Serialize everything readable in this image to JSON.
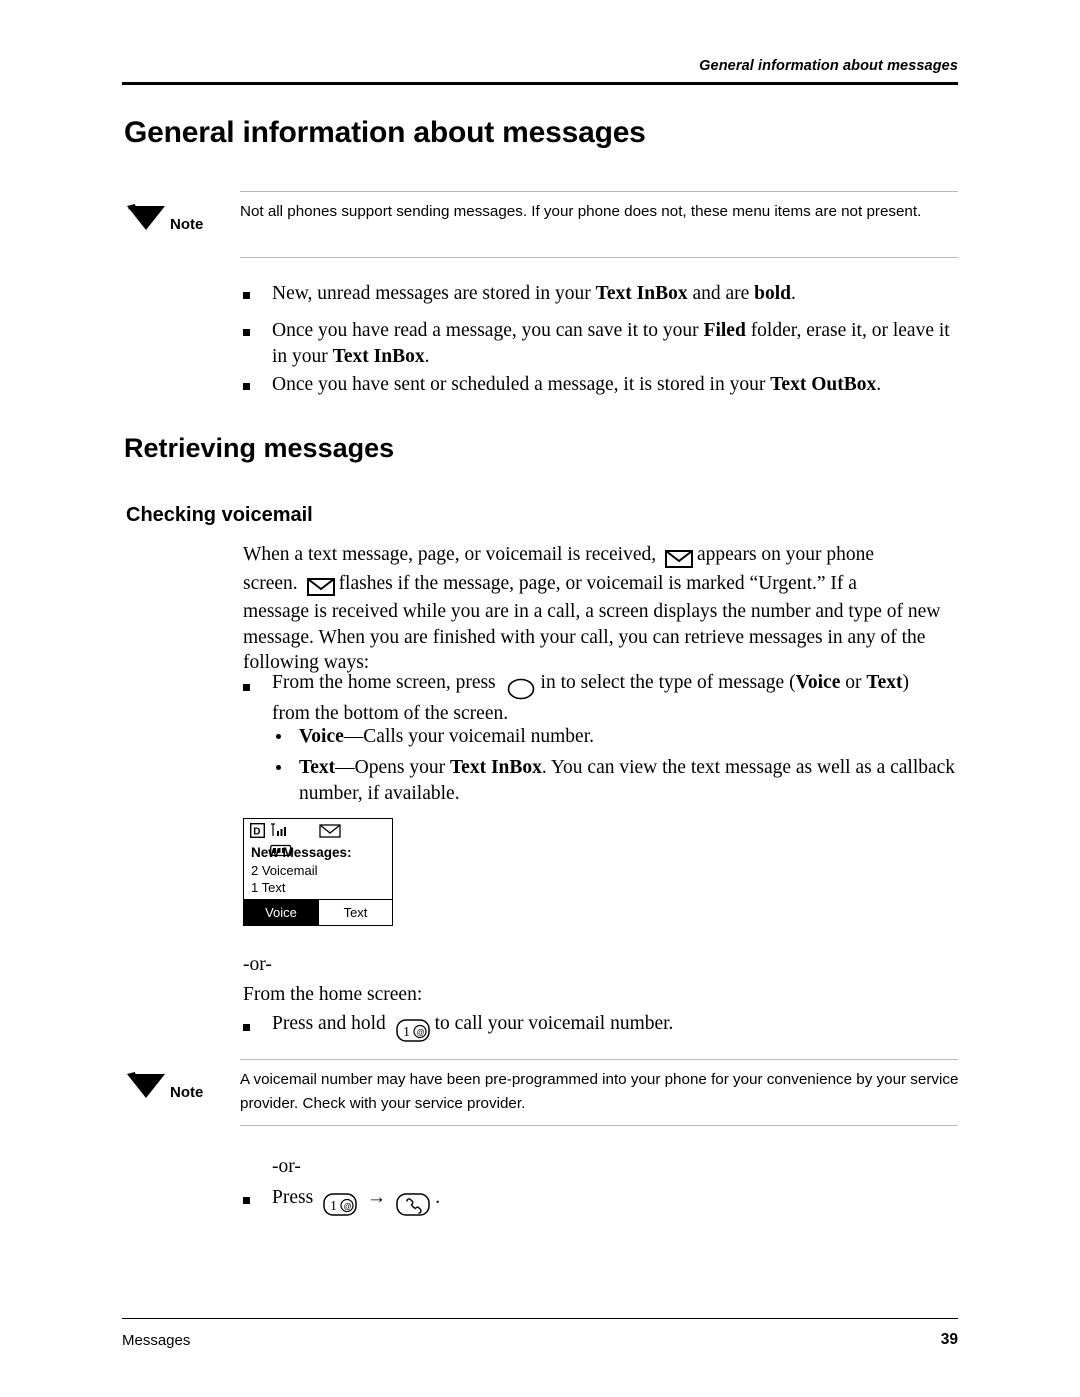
{
  "header": {
    "running_head": "General information about messages"
  },
  "footer": {
    "chapter": "Messages",
    "page_number": "39"
  },
  "headings": {
    "h1": "General information about messages",
    "h2": "Retrieving messages",
    "h3": "Checking voicemail"
  },
  "note1": {
    "label": "Note",
    "text": "Not all phones support sending messages. If your phone does not, these menu items are not present."
  },
  "note2": {
    "label": "Note",
    "text": "A voicemail number may have been pre-programmed into your phone for your convenience by your service provider. Check with your service provider."
  },
  "bullets_general": [
    {
      "parts": [
        {
          "t": "New, unread messages are stored in your ",
          "b": false
        },
        {
          "t": "Text InBox",
          "b": true
        },
        {
          "t": " and are ",
          "b": false
        },
        {
          "t": "bold",
          "b": true
        },
        {
          "t": ".",
          "b": false
        }
      ]
    },
    {
      "parts": [
        {
          "t": "Once you have read a message, you can save it to your ",
          "b": false
        },
        {
          "t": "Filed",
          "b": true
        },
        {
          "t": " folder, erase it, or leave it in your ",
          "b": false
        },
        {
          "t": "Text InBox",
          "b": true
        },
        {
          "t": ".",
          "b": false
        }
      ]
    },
    {
      "parts": [
        {
          "t": "Once you have sent or scheduled a message, it is stored in your ",
          "b": false
        },
        {
          "t": "Text OutBox",
          "b": true
        },
        {
          "t": ".",
          "b": false
        }
      ]
    }
  ],
  "voicemail": {
    "intro_1": "When a text message, page, or voicemail is received,",
    "intro_2": "appears on your phone",
    "intro_3": "screen.",
    "intro_4": "flashes if the message, page, or voicemail is marked “Urgent.” If a",
    "intro_rest": "message is received while you are in a call, a screen displays the number and type of new message. When you are finished with your call, you can retrieve messages in any of the following ways:",
    "bullet_press_1": "From the home screen, press",
    "bullet_press_2a": "in to select the type of message (",
    "bullet_press_voice": "Voice",
    "bullet_press_or": " or ",
    "bullet_press_text": "Text",
    "bullet_press_2b": ")",
    "bullet_press_3": "from the bottom of the screen.",
    "sub_voice_bold": "Voice",
    "sub_voice_rest": "—Calls your voicemail number.",
    "sub_text_bold": "Text",
    "sub_text_rest_a": "—Opens your ",
    "sub_text_bold2": "Text InBox",
    "sub_text_rest_b": ". You can view the text message as well as a callback number, if available.",
    "or_1": "-or-",
    "from_home": "From the home screen:",
    "press_hold_a": "Press and hold",
    "press_hold_b": "to call your voicemail number.",
    "or_2": "-or-",
    "press_final": "Press",
    "press_final_end": "."
  },
  "phone_screen": {
    "status_icons": [
      "digital-icon",
      "signal-bars-icon",
      "envelope-icon",
      "battery-icon"
    ],
    "title": "New Messages:",
    "line1": "2 Voicemail",
    "line2": "1 Text",
    "softkey_left": "Voice",
    "softkey_right": "Text"
  },
  "icons": {
    "note": "note-flag-icon",
    "envelope": "envelope-icon",
    "nav_key": "navigation-key-icon",
    "key_one": "key-1-icon",
    "send_key": "send-key-icon",
    "arrow": "→"
  },
  "colors": {
    "text": "#000000",
    "rule": "#b9b9b9",
    "header_rule": "#000000"
  }
}
